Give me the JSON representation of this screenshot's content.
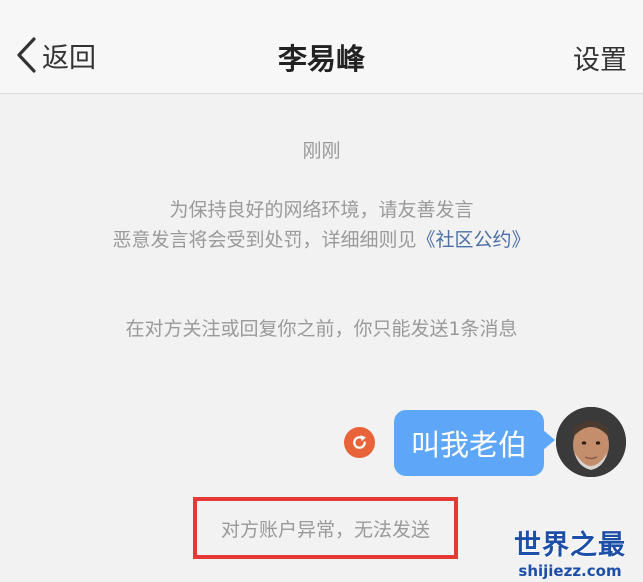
{
  "header": {
    "back_label": "返回",
    "title": "李易峰",
    "settings_label": "设置"
  },
  "chat": {
    "time": "刚刚",
    "notice_line1": "为保持良好的网络环境，请友善发言",
    "notice_line2_prefix": "恶意发言将会受到处罚，详细细则见",
    "notice_link": "《社区公约》",
    "limit_notice": "在对方关注或回复你之前，你只能发送1条消息",
    "message_text": "叫我老伯",
    "error_text": "对方账户异常，无法发送"
  },
  "watermark": {
    "title": "世界之最",
    "url": "shijiezz.com"
  },
  "colors": {
    "bubble": "#5ea6f7",
    "resend": "#e8623a",
    "highlight_box": "#e53935",
    "link": "#4a6fa5"
  }
}
